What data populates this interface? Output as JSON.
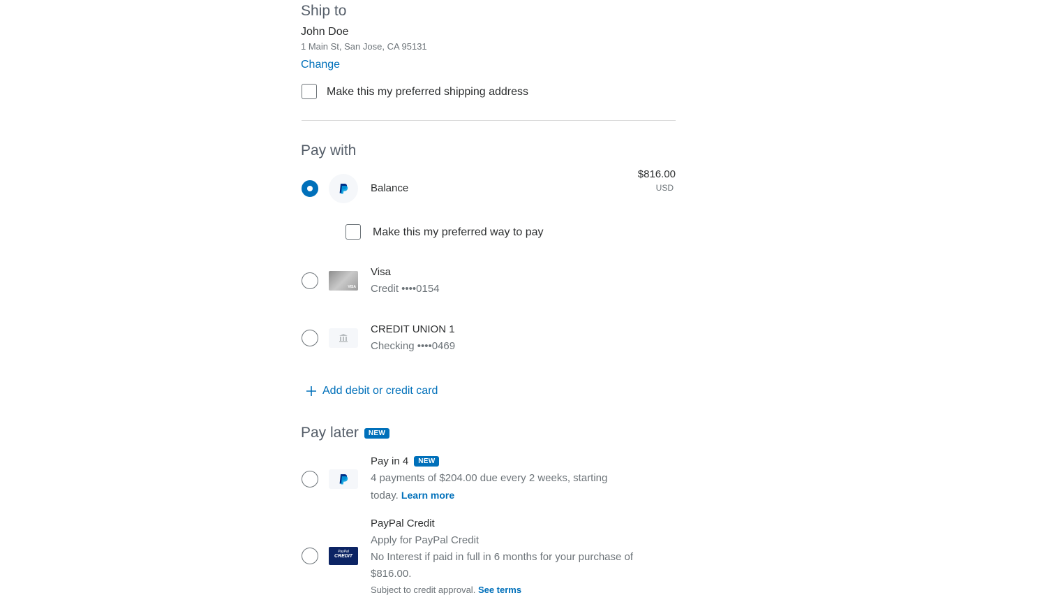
{
  "ship_to": {
    "heading": "Ship to",
    "name": "John Doe",
    "address": "1 Main St, San Jose, CA 95131",
    "change_link": "Change",
    "preferred_checkbox_label": "Make this my preferred shipping address"
  },
  "pay_with": {
    "heading": "Pay with",
    "balance": {
      "label": "Balance",
      "amount": "$816.00",
      "currency": "USD",
      "selected": true
    },
    "preferred_checkbox_label": "Make this my preferred way to pay",
    "visa": {
      "title": "Visa",
      "subtitle": "Credit ••••0154"
    },
    "bank": {
      "title": "CREDIT UNION 1",
      "subtitle": "Checking ••••0469"
    },
    "add_card_link": "Add debit or credit card"
  },
  "pay_later": {
    "heading": "Pay later",
    "badge": "NEW",
    "pay_in_4": {
      "title": "Pay in 4",
      "badge": "NEW",
      "desc_line1": "4 payments of $204.00 due every 2 weeks, starting",
      "desc_line2": "today.",
      "learn_more": "Learn more"
    },
    "paypal_credit": {
      "title": "PayPal Credit",
      "subtitle": "Apply for PayPal Credit",
      "desc_line1": "No Interest if paid in full in 6 months for your purchase of",
      "desc_line2": "$816.00.",
      "footnote": "Subject to credit approval.",
      "see_terms": "See terms",
      "logo_text_top": "PayPal",
      "logo_text_bottom": "CREDIT"
    }
  },
  "colors": {
    "accent": "#0070ba",
    "paypal_dark_blue": "#003087",
    "paypal_light_blue": "#009cde",
    "credit_card_bg": "#0c2464"
  }
}
